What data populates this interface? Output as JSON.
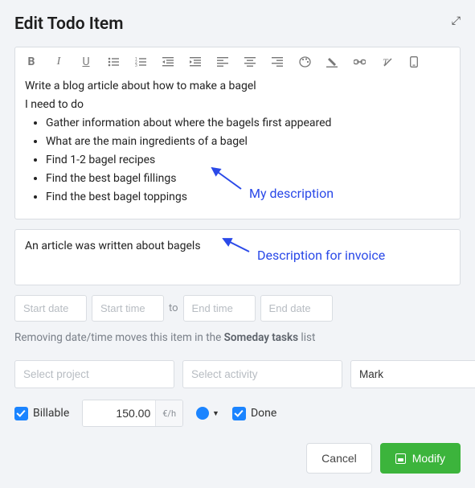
{
  "header": {
    "title": "Edit Todo Item"
  },
  "editor": {
    "line1": "Write  a blog article about how to make a bagel",
    "line2": "I need to do",
    "bullets": [
      "Gather information about where the bagels first appeared",
      "What are the main ingredients of a bagel",
      "Find 1-2 bagel recipes",
      "Find the best bagel fillings",
      "Find the best bagel toppings"
    ]
  },
  "invoice": {
    "text": "An article was written about bagels"
  },
  "dates": {
    "start_date_ph": "Start date",
    "start_time_ph": "Start time",
    "to_label": "to",
    "end_time_ph": "End time",
    "end_date_ph": "End date"
  },
  "hint": {
    "prefix": "Removing date/time moves this item in the ",
    "bold": "Someday tasks",
    "suffix": " list"
  },
  "selects": {
    "project_ph": "Select project",
    "activity_ph": "Select activity",
    "user_value": "Mark"
  },
  "billable": {
    "label": "Billable",
    "rate_value": "150.00",
    "rate_unit": "€/h"
  },
  "done": {
    "label": "Done"
  },
  "actions": {
    "cancel": "Cancel",
    "modify": "Modify"
  },
  "annotations": {
    "my_desc": "My description",
    "invoice_desc": "Description for invoice"
  },
  "colors": {
    "accent_blue": "#1b84ff",
    "primary_green": "#3cb43c",
    "annotation_blue": "#2a49e8"
  }
}
